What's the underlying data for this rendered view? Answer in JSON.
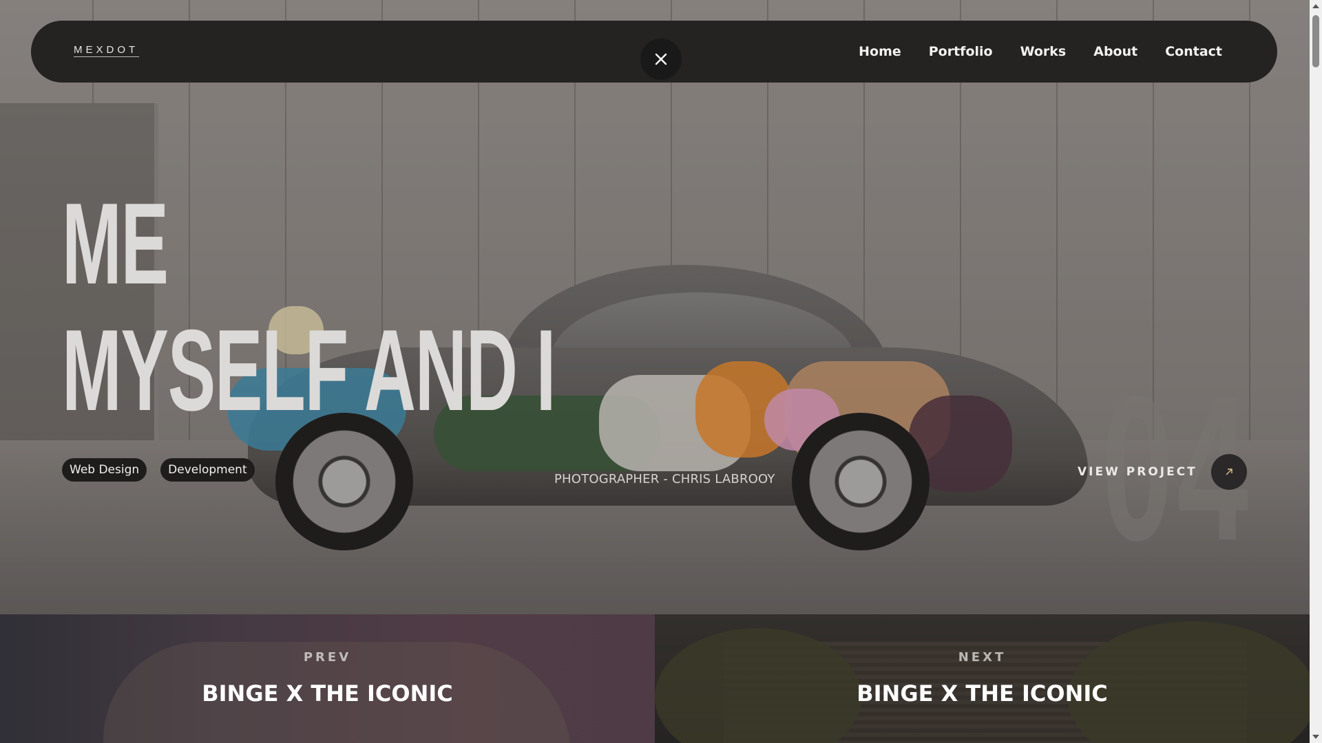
{
  "header": {
    "logo": "MEXDOT",
    "nav": [
      "Home",
      "Portfolio",
      "Works",
      "About",
      "Contact"
    ]
  },
  "hero": {
    "title_line1": "ME",
    "title_line2": "MYSELF AND I",
    "tags": [
      "Web Design",
      "Development"
    ],
    "credit": "PHOTOGRAPHER - CHRIS LABROOY",
    "number": "04",
    "view_project": "VIEW PROJECT"
  },
  "pager": {
    "prev": {
      "kicker": "PREV",
      "title": "BINGE X THE ICONIC"
    },
    "next": {
      "kicker": "NEXT",
      "title": "BINGE X THE ICONIC"
    }
  },
  "icons": {
    "close": "close-icon",
    "arrow": "arrow-up-right-icon"
  },
  "colors": {
    "header_bg": "#252322",
    "tag_bg": "#1f1d1c",
    "title_text": "#dcdad8"
  }
}
